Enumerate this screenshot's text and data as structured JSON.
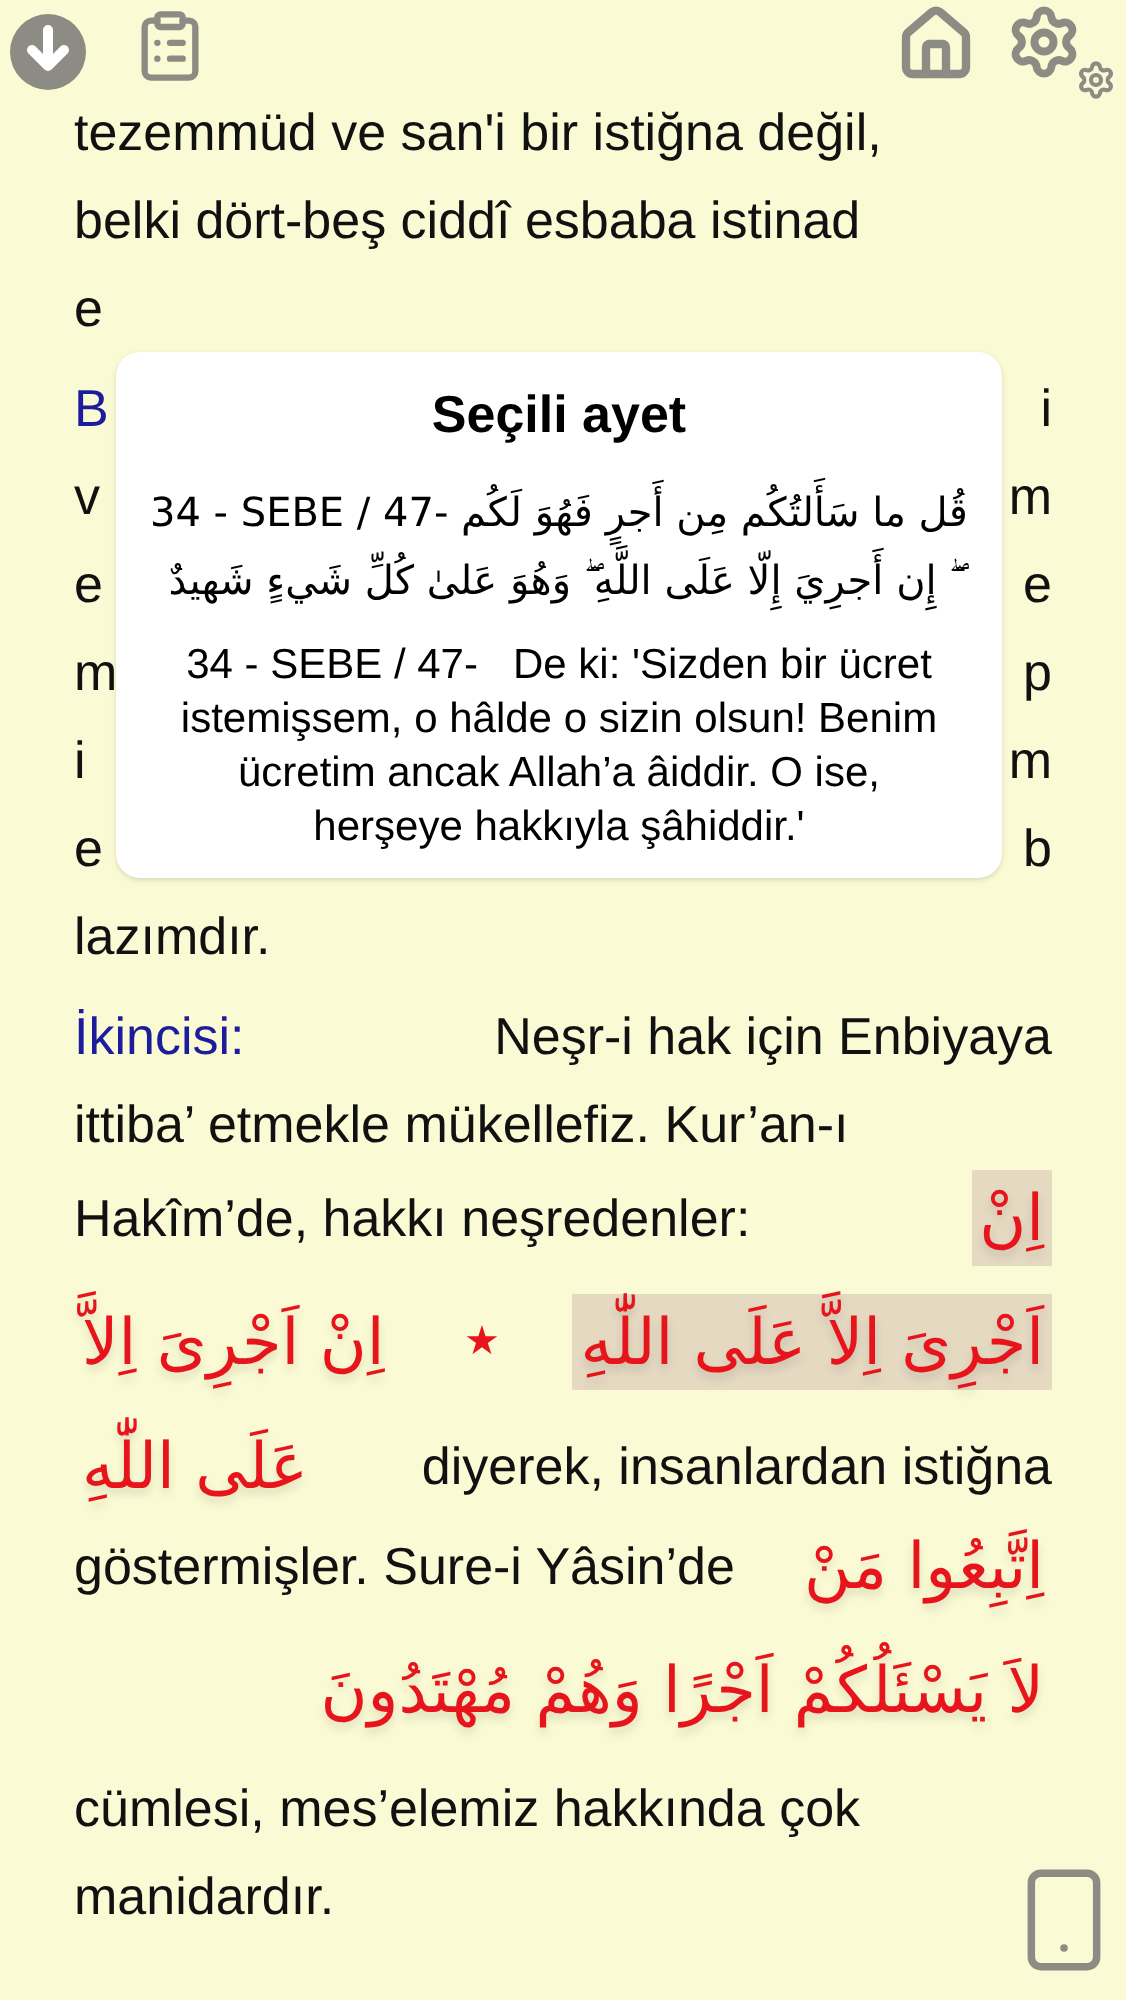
{
  "paragraphs": [
    {
      "lines": [
        {
          "text": "tezemmüd ve san'i bir istiğna değil,"
        },
        {
          "text": "belki dört-beş ciddî esbaba istinad"
        },
        {
          "text": "e"
        }
      ]
    },
    {
      "lines": [
        {
          "label": "B",
          "text_end": "i"
        },
        {
          "text": "v",
          "text_end": "m"
        },
        {
          "text": "e",
          "text_end": "e"
        },
        {
          "text": "m",
          "text_end": "p"
        },
        {
          "text": "i",
          "text_end": "m"
        },
        {
          "text": "e",
          "text_end": "b"
        },
        {
          "text": "lazımdır."
        }
      ]
    },
    {
      "lines": [
        {
          "label": "İkincisi:",
          "text_end": "Neşr-i hak için Enbiyaya"
        },
        {
          "text": "ittiba’ etmekle mükellefiz. Kur’an-ı"
        },
        {
          "text": "Hakîm’de, hakkı neşredenler:",
          "arabic_end": {
            "text": "اِنْ",
            "highlighted": true
          }
        },
        {
          "rtl": true,
          "segments": [
            {
              "kind": "arabic",
              "text": "اَجْرِىَ اِلاَّ عَلَى اللّٰهِ",
              "highlighted": true
            },
            {
              "kind": "star",
              "text": "★"
            },
            {
              "kind": "arabic",
              "text": "اِنْ اَجْرِىَ اِلاَّ",
              "highlighted": false
            }
          ]
        },
        {
          "arabic_start": {
            "text": "عَلَى اللّٰهِ",
            "highlighted": false
          },
          "text_end": "diyerek, insanlardan istiğna"
        },
        {
          "text": "göstermişler. Sure-i Yâsin’de",
          "arabic_end": {
            "text": "اِتَّبِعُوا مَنْ",
            "highlighted": false
          }
        },
        {
          "rtl": true,
          "segments": [
            {
              "kind": "arabic",
              "text": "لاَ يَسْئَلُكُمْ اَجْرًا وَهُمْ مُهْتَدُونَ",
              "highlighted": false
            }
          ]
        },
        {
          "text": "cümlesi, mes’elemiz hakkında çok"
        },
        {
          "text": "manidardır."
        }
      ]
    }
  ],
  "popup": {
    "title": "Seçili ayet",
    "verse": "34 - SEBE / 47- قُل ما سَأَلتُكُم مِن أَجرٍ فَهُوَ لَكُم ۖ إِن أَجرِيَ إِلّا عَلَى اللَّهِ ۖ وَهُوَ عَلىٰ كُلِّ شَيءٍ شَهيدٌ",
    "translation": "34 - SEBE / 47-   De ki: 'Sizden bir ücret istemişsem, o hâlde o sizin olsun! Benim ücretim ancak Allah’a âiddir. O ise, herşeye hakkıyla şâhiddir.'"
  }
}
